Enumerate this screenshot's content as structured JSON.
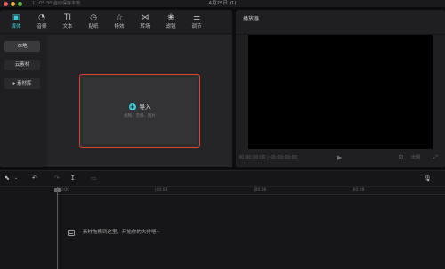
{
  "titlebar": {
    "autosave": "11:05:30 自动保存本地",
    "project_date": "4月25日 (1)"
  },
  "toolbar": {
    "tools": [
      {
        "label": "媒体",
        "icon": "media-icon",
        "glyph": "▣"
      },
      {
        "label": "音频",
        "icon": "audio-icon",
        "glyph": "◔"
      },
      {
        "label": "文本",
        "icon": "text-icon",
        "glyph": "TI"
      },
      {
        "label": "贴纸",
        "icon": "sticker-icon",
        "glyph": "◷"
      },
      {
        "label": "特效",
        "icon": "effects-icon",
        "glyph": "☆"
      },
      {
        "label": "转场",
        "icon": "transition-icon",
        "glyph": "⋈"
      },
      {
        "label": "滤镜",
        "icon": "filter-icon",
        "glyph": "❀"
      },
      {
        "label": "调节",
        "icon": "adjust-icon",
        "glyph": "⚌"
      }
    ],
    "active_index": 0,
    "accent_color": "#3ec7d4"
  },
  "sidebar": {
    "items": [
      {
        "label": "本地"
      },
      {
        "label": "云素材"
      },
      {
        "label": "▸ 素材库"
      }
    ]
  },
  "import": {
    "label": "导入",
    "hint": "视频、音频、图片",
    "border_color": "#e2412f"
  },
  "player": {
    "title": "播放器",
    "timecode": "00:00:00:00 | 00:00:00:00",
    "ratio_label": "比例"
  },
  "timeline": {
    "ruler_labels": [
      "00:00",
      "|00:03",
      "|00:06",
      "|00:09"
    ],
    "empty_hint": "素材拖拽到这里，开始你的大作吧~"
  }
}
